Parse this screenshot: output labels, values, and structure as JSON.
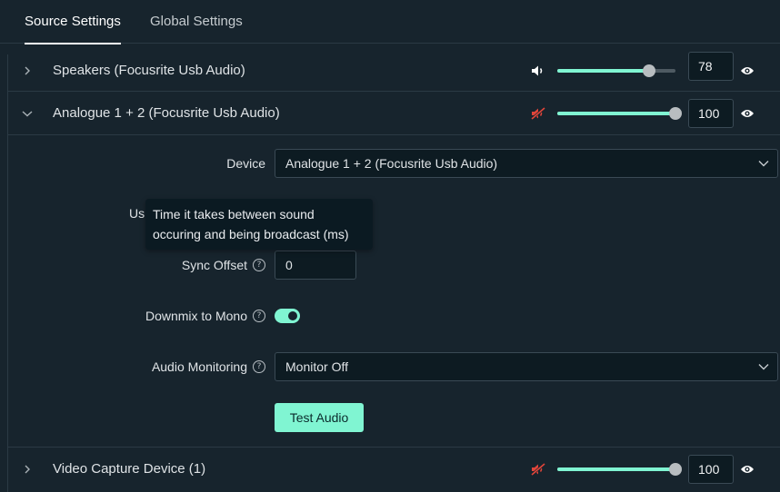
{
  "tabs": [
    {
      "label": "Source Settings",
      "active": true
    },
    {
      "label": "Global Settings",
      "active": false
    }
  ],
  "sources": [
    {
      "name": "Speakers (Focusrite Usb Audio)",
      "expanded": false,
      "muted": false,
      "volume": 78,
      "volume_text": "78"
    },
    {
      "name": "Analogue 1 + 2 (Focusrite Usb Audio)",
      "expanded": true,
      "muted": true,
      "volume": 100,
      "volume_text": "100"
    },
    {
      "name": "Video Capture Device (1)",
      "expanded": false,
      "muted": true,
      "volume": 100,
      "volume_text": "100"
    }
  ],
  "form": {
    "device_label": "Device",
    "device_value": "Analogue 1 + 2 (Focusrite Usb Audio)",
    "partial_label": "Us",
    "tooltip_text": "Time it takes between sound occuring and being broadcast (ms)",
    "sync_offset_label": "Sync Offset",
    "sync_offset_value": "0",
    "downmix_label": "Downmix to Mono",
    "downmix_on": true,
    "monitoring_label": "Audio Monitoring",
    "monitoring_value": "Monitor Off",
    "test_button": "Test Audio"
  },
  "colors": {
    "background": "#17242d",
    "accent": "#80f5d2",
    "muted_icon": "#e0453a",
    "border": "#2b3a44"
  },
  "icons": {
    "collapsed": "chevron-right-icon",
    "expanded": "chevron-down-icon",
    "volume": "speaker-icon",
    "muted": "speaker-muted-icon",
    "visibility": "eye-icon",
    "help": "question-circle-icon",
    "dropdown": "chevron-down-icon"
  }
}
